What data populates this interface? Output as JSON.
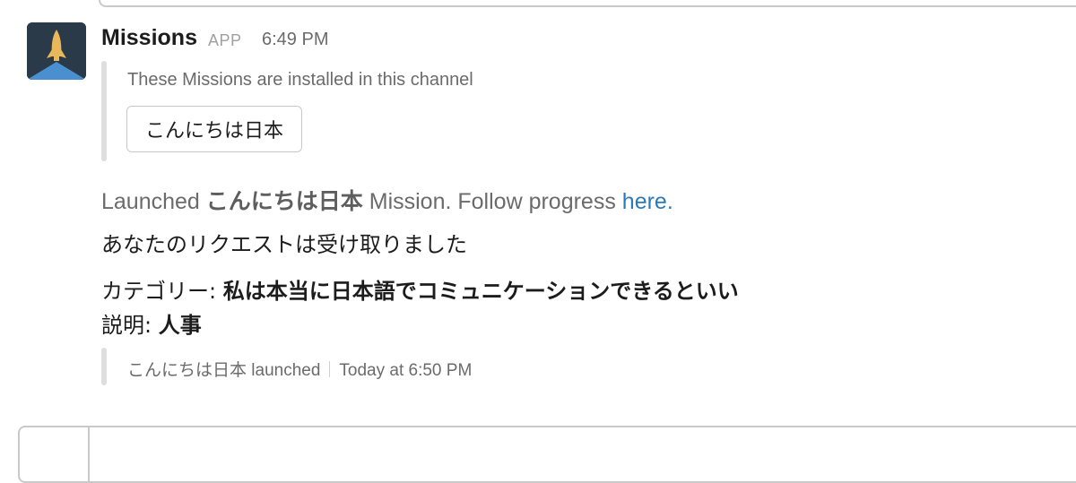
{
  "message": {
    "sender": "Missions",
    "badge": "APP",
    "time": "6:49 PM",
    "attachment": {
      "text": "These Missions are installed in this channel",
      "button_label": "こんにちは日本"
    },
    "launched": {
      "prefix": "Launched",
      "mission_name": "こんにちは日本",
      "middle": "Mission. Follow progress",
      "link_text": "here."
    },
    "request_text": "あなたのリクエストは受け取りました",
    "category": {
      "label": "カテゴリー:",
      "value": "私は本当に日本語でコミュニケーションできるといい"
    },
    "description": {
      "label": "説明:",
      "value": "人事"
    },
    "footer": {
      "source": "こんにちは日本 launched",
      "timestamp": "Today at 6:50 PM"
    }
  },
  "colors": {
    "link": "#2a7ab8",
    "avatar_bg": "#2a3a48",
    "rocket": "#e8b85a",
    "exhaust": "#4a90d0"
  },
  "icons": {
    "avatar": "rocket-icon"
  }
}
